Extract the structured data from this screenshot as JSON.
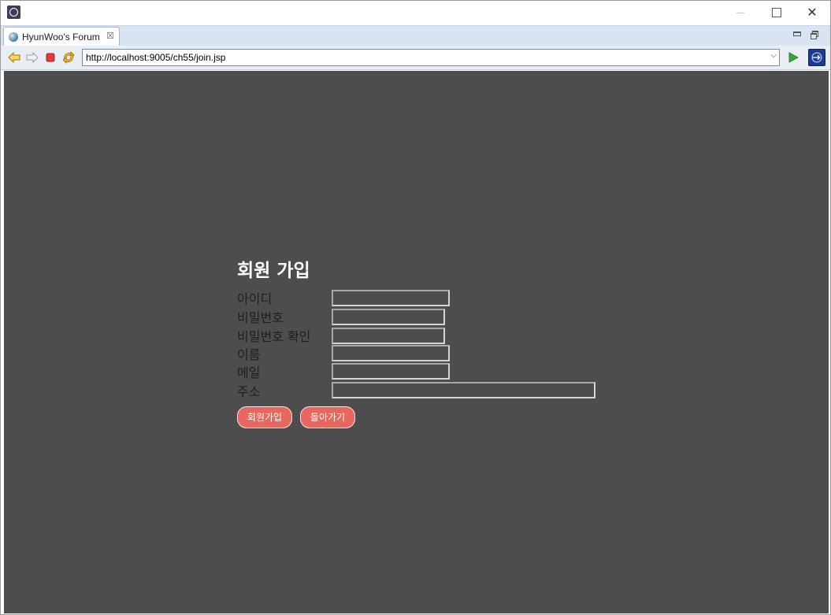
{
  "window": {
    "controls": [
      "minimize",
      "maximize",
      "close"
    ]
  },
  "tab": {
    "label": "HyunWoo's Forum",
    "close_glyph": "☒"
  },
  "toolbar": {
    "url": "http://localhost:9005/ch55/join.jsp",
    "dropdown_glyph": "⌵"
  },
  "page": {
    "title": "회원 가입",
    "fields": [
      {
        "label": "아이디",
        "value": ""
      },
      {
        "label": "비밀번호",
        "value": ""
      },
      {
        "label": "비밀번호 확인",
        "value": ""
      },
      {
        "label": "이름",
        "value": ""
      },
      {
        "label": "메일",
        "value": ""
      },
      {
        "label": "주소",
        "value": ""
      }
    ],
    "buttons": {
      "join": "회원가입",
      "back": "돌아가기"
    }
  },
  "colors": {
    "page_background": "#4d4d4d",
    "button": "#e8675e",
    "title": "#ffffff",
    "label": "#1e1e1e"
  }
}
